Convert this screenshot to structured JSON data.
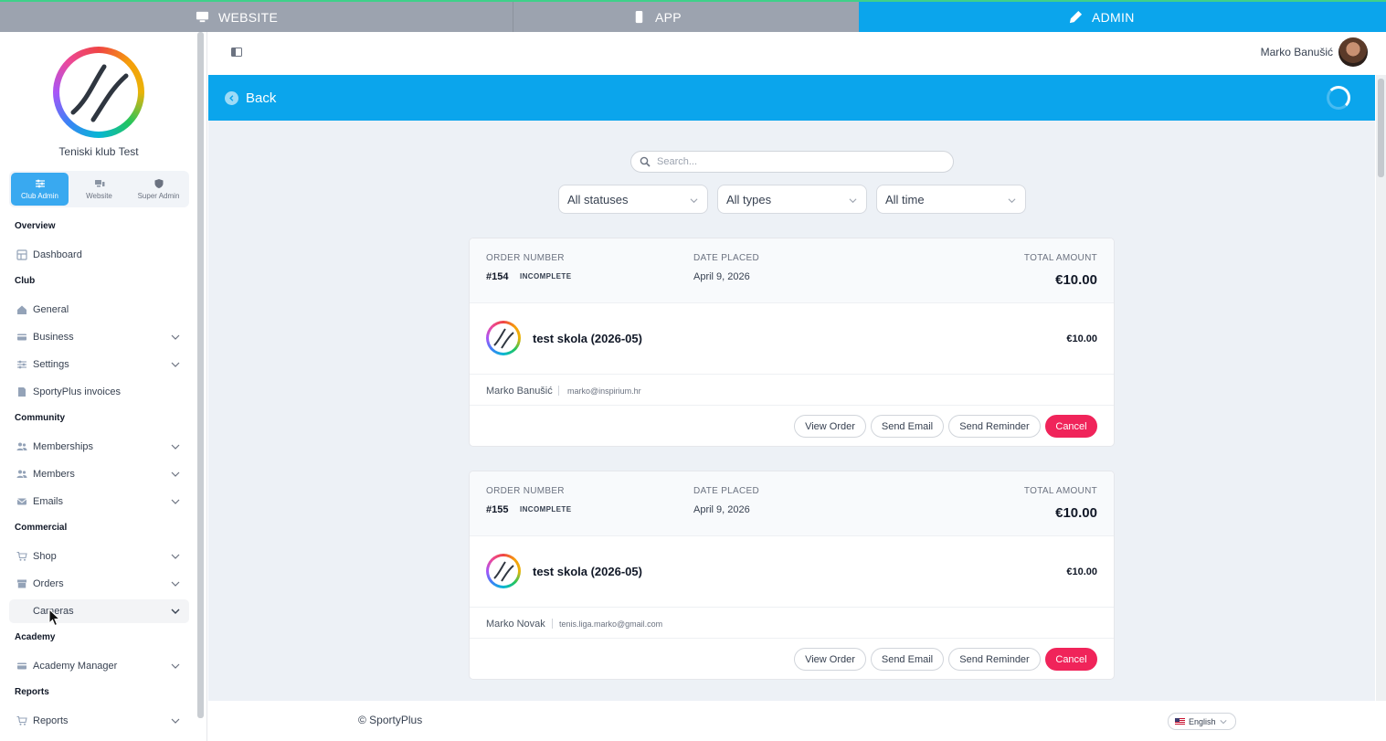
{
  "top_tabs": [
    {
      "label": "WEBSITE",
      "icon": "monitor-icon"
    },
    {
      "label": "APP",
      "icon": "phone-icon"
    },
    {
      "label": "ADMIN",
      "icon": "pen-icon",
      "active": true
    }
  ],
  "sidebar": {
    "club_name": "Teniski klub Test",
    "roles": [
      "Club Admin",
      "Website",
      "Super Admin"
    ],
    "sections": {
      "overview": "Overview",
      "club": "Club",
      "community": "Community",
      "commercial": "Commercial",
      "academy": "Academy",
      "reports": "Reports"
    },
    "items": {
      "dashboard": "Dashboard",
      "general": "General",
      "business": "Business",
      "settings": "Settings",
      "invoices": "SportyPlus invoices",
      "memberships": "Memberships",
      "members": "Members",
      "emails": "Emails",
      "shop": "Shop",
      "orders": "Orders",
      "cameras": "Cameras",
      "academy_manager": "Academy Manager",
      "reports": "Reports"
    }
  },
  "header": {
    "user_name": "Marko Banušić"
  },
  "band": {
    "back_label": "Back"
  },
  "filters": {
    "search_placeholder": "Search...",
    "status": "All statuses",
    "type": "All types",
    "time": "All time"
  },
  "labels": {
    "order_number": "ORDER NUMBER",
    "date_placed": "DATE PLACED",
    "total_amount": "TOTAL AMOUNT",
    "view_order": "View Order",
    "send_email": "Send Email",
    "send_reminder": "Send Reminder",
    "cancel": "Cancel"
  },
  "orders": [
    {
      "number": "#154",
      "status": "INCOMPLETE",
      "date": "April 9, 2026",
      "total": "€10.00",
      "product": "test skola (2026-05)",
      "product_price": "€10.00",
      "customer": "Marko Banušić",
      "email": "marko@inspirium.hr"
    },
    {
      "number": "#155",
      "status": "INCOMPLETE",
      "date": "April 9, 2026",
      "total": "€10.00",
      "product": "test skola (2026-05)",
      "product_price": "€10.00",
      "customer": "Marko Novak",
      "email": "tenis.liga.marko@gmail.com"
    }
  ],
  "footer": {
    "copyright": "© SportyPlus",
    "language": "English"
  },
  "colors": {
    "accent": "#0ba5ec",
    "danger": "#f0245a"
  }
}
